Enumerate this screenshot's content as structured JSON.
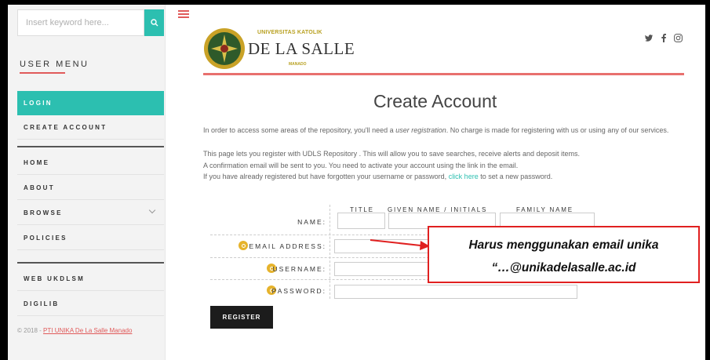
{
  "search": {
    "placeholder": "Insert keyword here..."
  },
  "sidebar": {
    "title": "USER MENU",
    "items": [
      {
        "label": "LOGIN"
      },
      {
        "label": "CREATE ACCOUNT"
      },
      {
        "label": "HOME"
      },
      {
        "label": "ABOUT"
      },
      {
        "label": "BROWSE"
      },
      {
        "label": "POLICIES"
      },
      {
        "label": "WEB UKDLSM"
      },
      {
        "label": "DIGILIB"
      }
    ],
    "copyright_prefix": "© 2018 - ",
    "copyright_link": "PTI UNIKA De La Salle Manado"
  },
  "header": {
    "univ_small": "UNIVERSITAS KATOLIK",
    "univ_big": "DE LA SALLE",
    "univ_city": "MANADO",
    "social": [
      "twitter-icon",
      "facebook-icon",
      "instagram-icon"
    ]
  },
  "main": {
    "title": "Create Account",
    "para1_a": "In order to access some areas of the repository, you'll need a ",
    "para1_em": "user registration",
    "para1_b": ". No charge is made for registering with us or using any of our services.",
    "para2": "This page lets you register with UDLS Repository . This will allow you to save searches, receive alerts and deposit items.",
    "para3": "A confirmation email will be sent to you. You need to activate your account using the link in the email.",
    "para4_a": "If you have already registered but have forgotten your username or password, ",
    "para4_link": "click here",
    "para4_b": " to set a new password."
  },
  "form": {
    "name_label": "NAME:",
    "col_title": "TITLE",
    "col_given": "GIVEN NAME / INITIALS",
    "col_family": "FAMILY NAME",
    "email_label": "EMAIL ADDRESS:",
    "username_label": "USERNAME:",
    "password_label": "PASSWORD:",
    "register_label": "REGISTER"
  },
  "annotation": {
    "line1": "Harus menggunakan email unika",
    "line2": "“…@unikadelasalle.ac.id"
  },
  "colors": {
    "accent": "#2cbfb0",
    "brand_red": "#e05a5a",
    "required": "#e6b32c",
    "annotation": "#e02020"
  }
}
